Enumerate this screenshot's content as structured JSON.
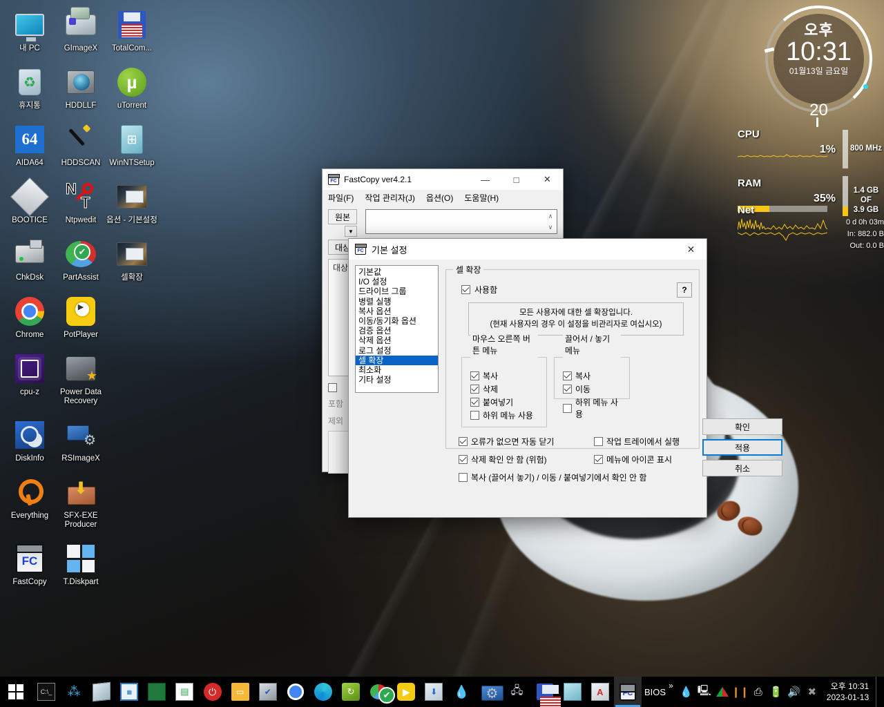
{
  "desktop": {
    "icons": [
      {
        "label": "내 PC",
        "icon": "my-computer-icon"
      },
      {
        "label": "GImageX",
        "icon": "gimagex-icon"
      },
      {
        "label": "TotalCom...",
        "icon": "totalcommander-icon"
      },
      {
        "label": "휴지통",
        "icon": "recycle-bin-icon"
      },
      {
        "label": "HDDLLF",
        "icon": "hddllf-icon"
      },
      {
        "label": "uTorrent",
        "icon": "utorrent-icon"
      },
      {
        "label": "AIDA64",
        "icon": "aida64-icon"
      },
      {
        "label": "HDDSCAN",
        "icon": "hddscan-icon"
      },
      {
        "label": "WinNTSetup",
        "icon": "winntsetup-icon"
      },
      {
        "label": "BOOTICE",
        "icon": "bootice-icon"
      },
      {
        "label": "Ntpwedit",
        "icon": "ntpwedit-icon"
      },
      {
        "label": "옵션 - 기본설정",
        "icon": "screenshot-icon"
      },
      {
        "label": "ChkDsk",
        "icon": "chkdsk-icon"
      },
      {
        "label": "PartAssist",
        "icon": "partassist-icon"
      },
      {
        "label": "셀확장",
        "icon": "screenshot-icon"
      },
      {
        "label": "Chrome",
        "icon": "chrome-icon"
      },
      {
        "label": "PotPlayer",
        "icon": "potplayer-icon"
      },
      {
        "label": "",
        "icon": "none"
      },
      {
        "label": "cpu-z",
        "icon": "cpuz-icon"
      },
      {
        "label": "Power Data Recovery",
        "icon": "power-data-recovery-icon"
      },
      {
        "label": "",
        "icon": "none"
      },
      {
        "label": "DiskInfo",
        "icon": "diskinfo-icon"
      },
      {
        "label": "RSImageX",
        "icon": "rsimagex-icon"
      },
      {
        "label": "",
        "icon": "none"
      },
      {
        "label": "Everything",
        "icon": "everything-icon"
      },
      {
        "label": "SFX-EXE Producer",
        "icon": "sfx-exe-icon"
      },
      {
        "label": "",
        "icon": "none"
      },
      {
        "label": "FastCopy",
        "icon": "fastcopy-icon"
      },
      {
        "label": "T.Diskpart",
        "icon": "diskpart-icon"
      }
    ]
  },
  "clock_gadget": {
    "ampm": "오후",
    "time": "10:31",
    "date": "01월13일 금요일",
    "seconds": "20"
  },
  "sysmon": {
    "cpu_label": "CPU",
    "cpu_percent": "1%",
    "cpu_freq": "800 MHz",
    "ram_label": "RAM",
    "ram_percent": "35%",
    "ram_used": "1.4 GB",
    "ram_of": "OF",
    "ram_total": "3.9 GB",
    "net_label": "Net",
    "uptime": "0 d 0h 03m",
    "net_in": "In: 882.0 B",
    "net_out": "Out: 0.0 B"
  },
  "fastcopy_window": {
    "title": "FastCopy ver4.2.1",
    "minimize": "—",
    "maximize": "□",
    "close": "✕",
    "menu": [
      "파일(F)",
      "작업 관리자(J)",
      "옵션(O)",
      "도움말(H)"
    ],
    "source_button": "원본",
    "dest_button": "대상",
    "source_value": "",
    "dest_value": "",
    "description": "대상 디렉터리에 따라서(자세히...",
    "include_label": "포함",
    "exclude_label": "제외"
  },
  "settings_dialog": {
    "title": "기본 설정",
    "close": "✕",
    "categories": [
      "기본값",
      "I/O 설정",
      "드라이브 그룹",
      "병렬 실행",
      "복사 옵션",
      "이동/동기화 옵션",
      "검증 옵션",
      "삭제 옵션",
      "로그 설정",
      "셀 확장",
      "최소화",
      "기타 설정"
    ],
    "selected_category": "셀 확장",
    "shell_group_title": "셀 확장",
    "enable_label": "사용함",
    "enable_checked": true,
    "help_button": "?",
    "info_line1": "모든 사용자에 대한 셀 확장입니다.",
    "info_line2": "(현재 사용자의 경우 이 설정을 비관리자로 여십시오)",
    "right_click_menu": {
      "title": "마우스 오른쪽 버튼 메뉴",
      "items": [
        {
          "label": "복사",
          "checked": true
        },
        {
          "label": "삭제",
          "checked": true
        },
        {
          "label": "붙여넣기",
          "checked": true
        },
        {
          "label": "하위 메뉴 사용",
          "checked": false
        }
      ]
    },
    "drag_drop_menu": {
      "title": "끌어서 / 놓기 메뉴",
      "items": [
        {
          "label": "복사",
          "checked": true
        },
        {
          "label": "이동",
          "checked": true
        },
        {
          "label": "하위 메뉴 사용",
          "checked": false
        }
      ]
    },
    "extra_options": [
      {
        "label": "오류가 없으면 자동 닫기",
        "checked": true
      },
      {
        "label": "작업 트레이에서 실행",
        "checked": false
      },
      {
        "label": "삭제 확인 안 함 (위험)",
        "checked": true
      },
      {
        "label": "메뉴에 아이콘 표시",
        "checked": true
      },
      {
        "label": "복사 (끌어서 놓기) / 이동 / 붙여넣기에서 확인 안 함",
        "checked": false
      }
    ],
    "buttons": [
      {
        "label": "확인",
        "primary": false
      },
      {
        "label": "적용",
        "primary": true
      },
      {
        "label": "취소",
        "primary": false
      }
    ]
  },
  "taskbar": {
    "start": "start-button",
    "items": [
      {
        "icon": "command-prompt-icon",
        "name": "command-prompt"
      },
      {
        "icon": "network-icon",
        "name": "network-tool"
      },
      {
        "icon": "notepad-icon",
        "name": "notepad"
      },
      {
        "icon": "calculator-icon",
        "name": "calculator"
      },
      {
        "icon": "circuit-board-icon",
        "name": "driver-tool"
      },
      {
        "icon": "partition-icon",
        "name": "partition-tool"
      },
      {
        "icon": "power-icon",
        "name": "power-tool"
      },
      {
        "icon": "folder-icon",
        "name": "file-explorer"
      },
      {
        "icon": "monitor-check-icon",
        "name": "system-tool"
      },
      {
        "icon": "chrome-icon",
        "name": "chrome"
      },
      {
        "icon": "edge-icon",
        "name": "edge"
      },
      {
        "icon": "hdd-green-icon",
        "name": "hdd-tool"
      },
      {
        "icon": "partassist-icon",
        "name": "partassist"
      },
      {
        "icon": "potplayer-icon",
        "name": "potplayer"
      },
      {
        "icon": "installer-icon",
        "name": "installer"
      },
      {
        "icon": "droplet-icon",
        "name": "droplet-tool"
      },
      {
        "icon": "rsimagex-icon",
        "name": "rsimagex"
      },
      {
        "icon": "usb-icon",
        "name": "usb-tool"
      },
      {
        "icon": "floppy-icon",
        "name": "totalcommander"
      },
      {
        "icon": "book-icon",
        "name": "book-tool"
      },
      {
        "icon": "pdf-icon",
        "name": "pdf-reader"
      },
      {
        "icon": "fastcopy-icon",
        "name": "fastcopy",
        "active": true
      }
    ],
    "tray": {
      "bios_label": "BIOS",
      "chevron": "»",
      "icons": [
        "droplet-icon",
        "monitor-icon",
        "triangle-icon",
        "battery-orange-icon",
        "usb-safe-icon",
        "battery-icon",
        "volume-icon",
        "close-circle-icon"
      ],
      "clock_time": "오후 10:31",
      "clock_date": "2023-01-13"
    }
  },
  "colors": {
    "accent": "#0a64c8",
    "primary_button_border": "#0a78d4",
    "taskbar_bg": "#000000",
    "gadget_yellow": "#f5c518"
  }
}
